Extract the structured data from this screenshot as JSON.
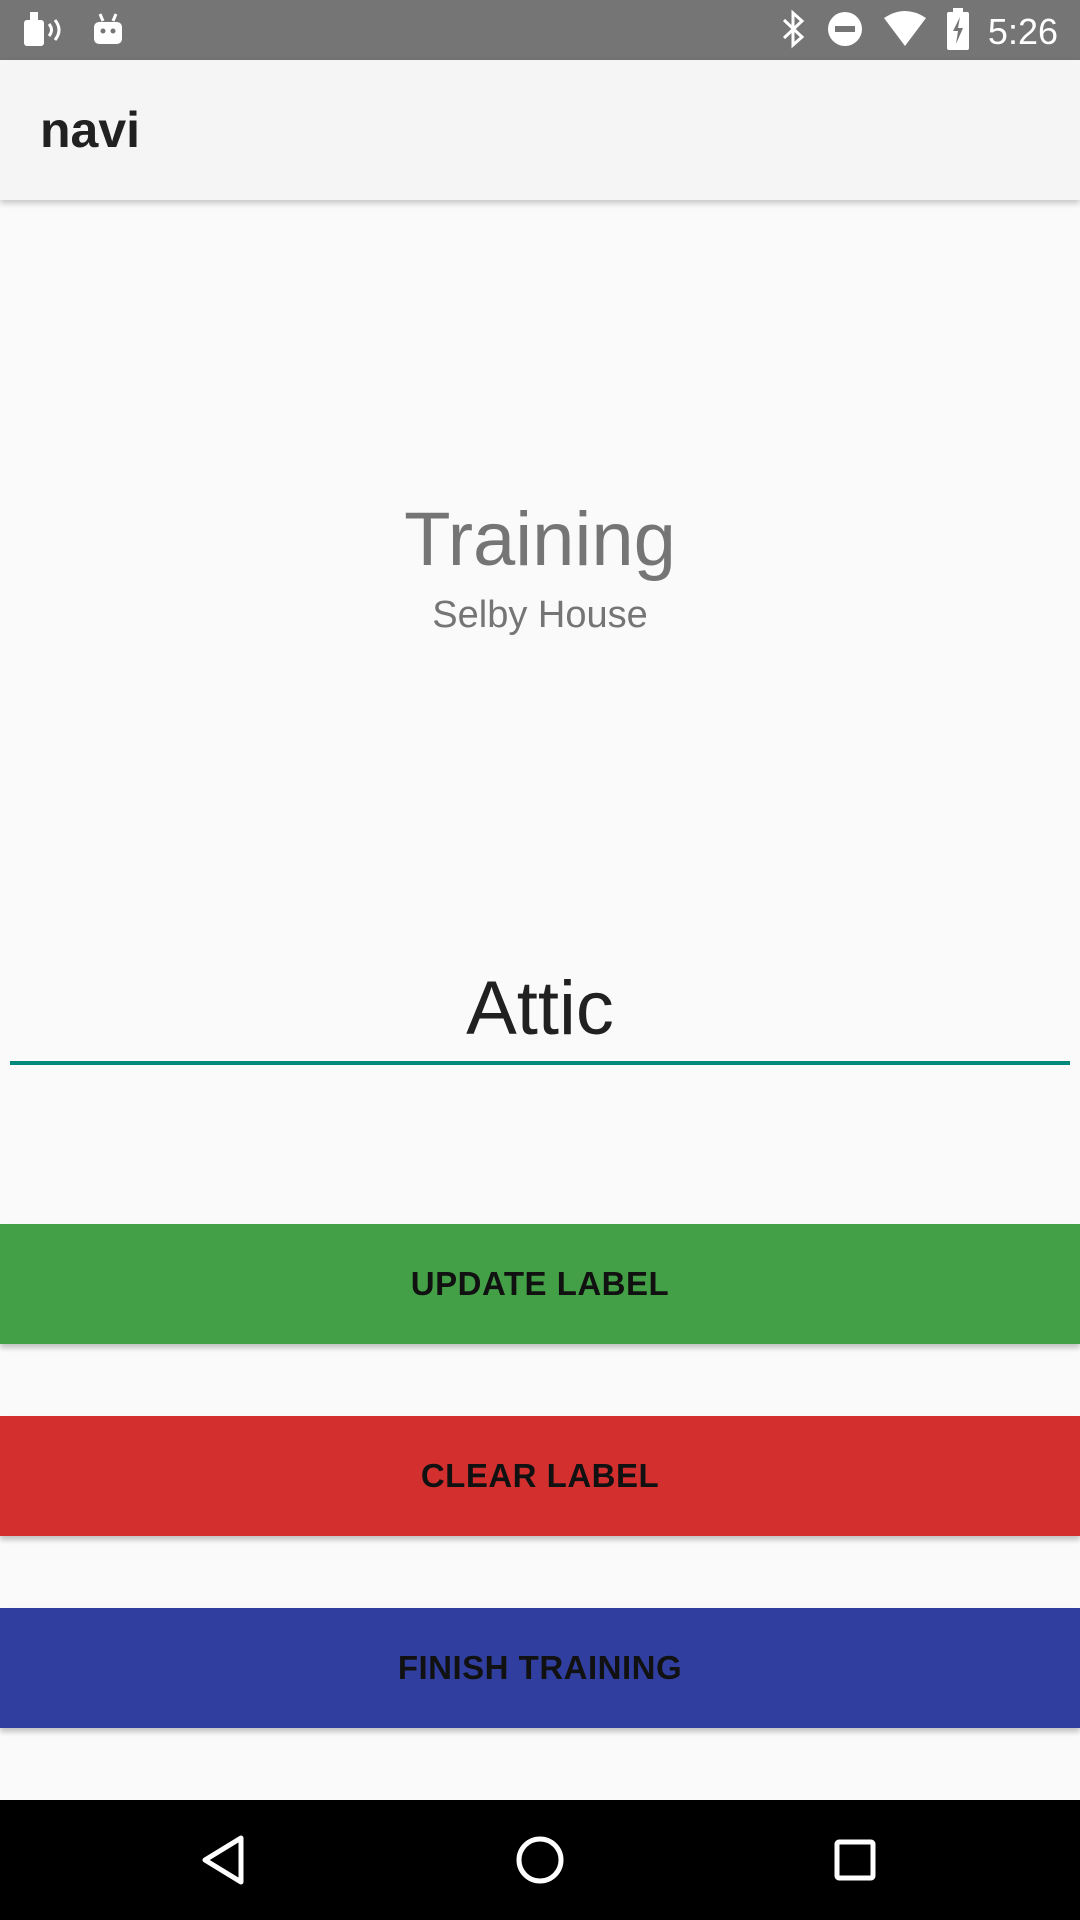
{
  "status_bar": {
    "time": "5:26",
    "icons": [
      "cast-audio-icon",
      "android-icon",
      "bluetooth-icon",
      "do-not-disturb-icon",
      "wifi-icon",
      "battery-charging-icon"
    ]
  },
  "app_bar": {
    "title": "navi"
  },
  "main": {
    "title": "Training",
    "subtitle": "Selby House",
    "label_value": "Attic",
    "input_accent": "#00897b"
  },
  "buttons": {
    "update": {
      "label": "UPDATE LABEL",
      "color": "#43a047"
    },
    "clear": {
      "label": "CLEAR LABEL",
      "color": "#d32f2f"
    },
    "finish": {
      "label": "FINISH TRAINING",
      "color": "#303f9f"
    }
  },
  "nav_bar": {
    "icons": [
      "back-icon",
      "home-icon",
      "recents-icon"
    ]
  }
}
